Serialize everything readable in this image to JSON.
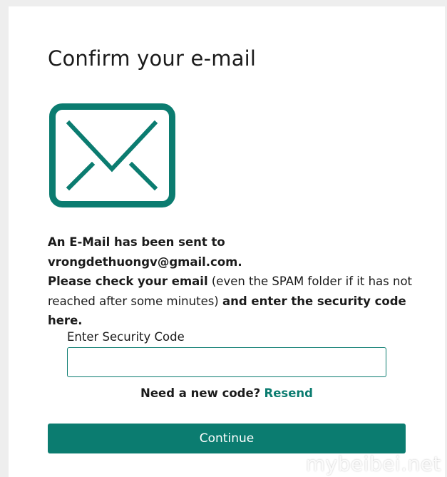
{
  "page": {
    "title": "Confirm your e-mail"
  },
  "icons": {
    "envelope": "envelope-icon"
  },
  "message": {
    "part1_bold": "An E-Mail has been sent to vrongdethuongv@gmail.com.",
    "part2_bold": "Please check your email",
    "part3_normal": " (even the SPAM folder if it has not reached after some minutes) ",
    "part4_bold": "and enter the security code here."
  },
  "form": {
    "code_label": "Enter Security Code",
    "code_value": "",
    "code_placeholder": ""
  },
  "resend": {
    "question": "Need a new code?",
    "link_label": "Resend"
  },
  "actions": {
    "continue_label": "Continue"
  },
  "watermark": {
    "text": "mybeibei.net"
  },
  "colors": {
    "accent": "#0b7c70",
    "text": "#1b1b1b",
    "background": "#eeeeee",
    "card": "#ffffff"
  }
}
